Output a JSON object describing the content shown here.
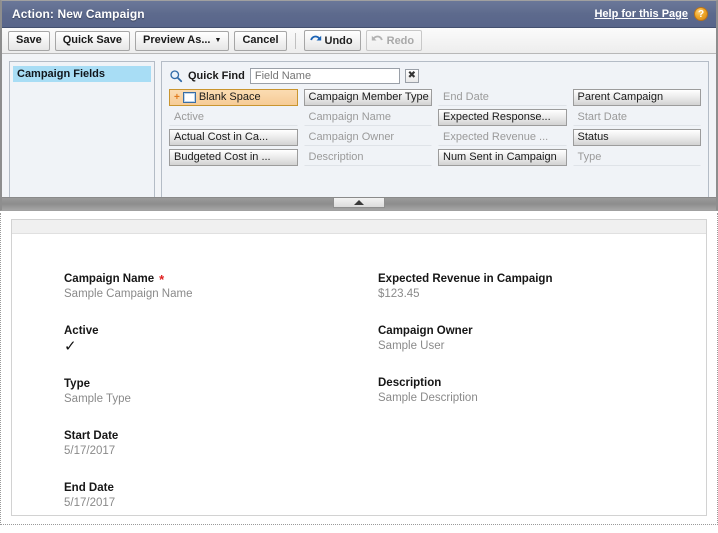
{
  "header": {
    "title": "Action: New Campaign",
    "help_label": "Help for this Page",
    "help_icon": "question-mark-icon",
    "bar_color": "#5d6a8d"
  },
  "toolbar": {
    "save_label": "Save",
    "quick_save_label": "Quick Save",
    "preview_as_label": "Preview As...",
    "preview_caret": "▼",
    "cancel_label": "Cancel",
    "undo_label": "Undo",
    "undo_icon": "undo-arrow-icon",
    "redo_label": "Redo",
    "redo_icon": "redo-arrow-icon",
    "redo_disabled": true
  },
  "sidebar": {
    "items": [
      {
        "label": "Campaign Fields",
        "selected": true
      }
    ]
  },
  "palette": {
    "search_icon": "magnifier-icon",
    "quick_find_label": "Quick Find",
    "quick_find_value": "",
    "quick_find_placeholder": "Field Name",
    "clear_label": "✖",
    "highlight_color": "#f6cb96",
    "fields": [
      {
        "label": "Blank Space",
        "state": "highlight",
        "icon": "blank-space-icon",
        "plus": "+"
      },
      {
        "label": "Campaign Member Type",
        "state": "available"
      },
      {
        "label": "End Date",
        "state": "used"
      },
      {
        "label": "Parent Campaign",
        "state": "available"
      },
      {
        "label": "Active",
        "state": "used"
      },
      {
        "label": "Campaign Name",
        "state": "used"
      },
      {
        "label": "Expected Response...",
        "state": "available"
      },
      {
        "label": "Start Date",
        "state": "used"
      },
      {
        "label": "Actual Cost in Ca...",
        "state": "available"
      },
      {
        "label": "Campaign Owner",
        "state": "used"
      },
      {
        "label": "Expected Revenue ...",
        "state": "used"
      },
      {
        "label": "Status",
        "state": "available"
      },
      {
        "label": "Budgeted Cost in ...",
        "state": "available"
      },
      {
        "label": "Description",
        "state": "used"
      },
      {
        "label": "Num Sent in Campaign",
        "state": "available"
      },
      {
        "label": "Type",
        "state": "used"
      }
    ]
  },
  "splitter": {
    "handle_icon": "collapse-triangle-up-icon"
  },
  "preview": {
    "left_column": [
      {
        "label": "Campaign Name",
        "required": true,
        "value": "Sample Campaign Name",
        "type": "text"
      },
      {
        "label": "Active",
        "required": false,
        "value": "✓",
        "type": "checkbox"
      },
      {
        "label": "Type",
        "required": false,
        "value": "Sample Type",
        "type": "text"
      },
      {
        "label": "Start Date",
        "required": false,
        "value": "5/17/2017",
        "type": "text"
      },
      {
        "label": "End Date",
        "required": false,
        "value": "5/17/2017",
        "type": "text"
      }
    ],
    "right_column": [
      {
        "label": "Expected Revenue in Campaign",
        "required": false,
        "value": "$123.45",
        "type": "text"
      },
      {
        "label": "Campaign Owner",
        "required": false,
        "value": "Sample User",
        "type": "text"
      },
      {
        "label": "Description",
        "required": false,
        "value": "Sample Description",
        "type": "text"
      }
    ]
  }
}
